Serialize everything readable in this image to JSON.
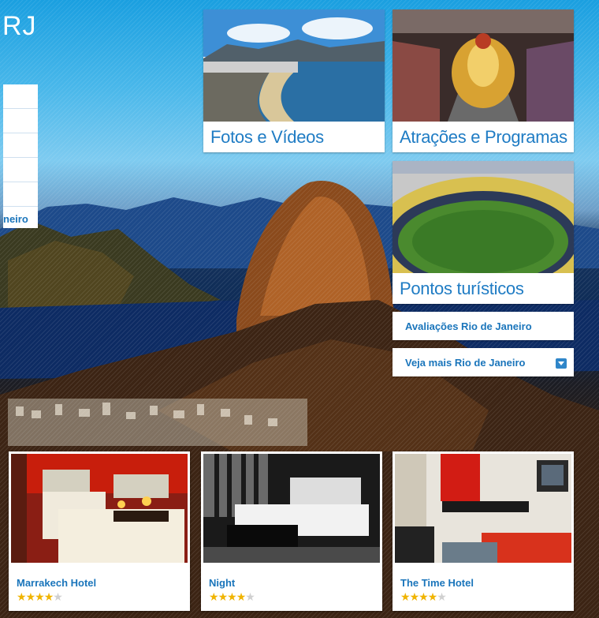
{
  "header": {
    "title": "RJ"
  },
  "side_menu": {
    "last_item": "neiro"
  },
  "tiles": {
    "photos": "Fotos e Vídeos",
    "attractions": "Atrações e Programas",
    "landmarks": "Pontos turísticos"
  },
  "links": {
    "reviews": "Avaliações Rio de Janeiro",
    "more": "Veja mais Rio de Janeiro"
  },
  "hotels": [
    {
      "name": "Marrakech Hotel",
      "rating": 4,
      "stars_max": 5
    },
    {
      "name": "Night",
      "rating": 4,
      "stars_max": 5
    },
    {
      "name": "The Time Hotel",
      "rating": 4,
      "stars_max": 5
    }
  ],
  "colors": {
    "link": "#1a75bb",
    "star_on": "#f0b400",
    "star_off": "#d0d0d0"
  }
}
